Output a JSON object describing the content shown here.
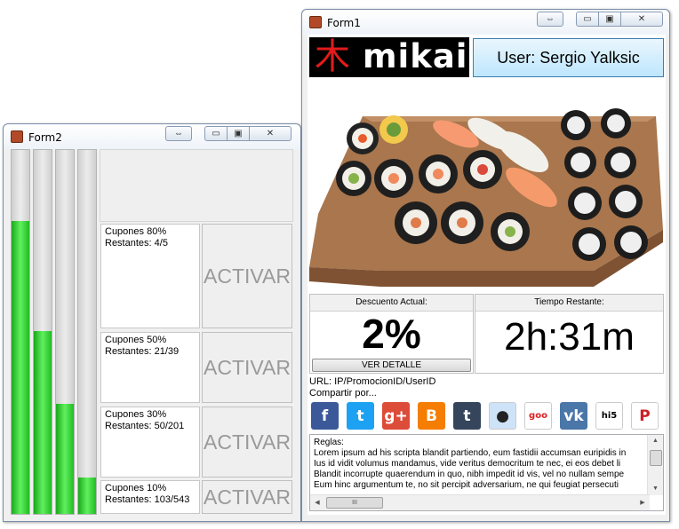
{
  "form2": {
    "title": "Form2",
    "title_buttons": {
      "resize_icon": "resize-arrows-icon",
      "minimize_icon": "minimize-icon",
      "restore_icon": "restore-icon",
      "close_icon": "close-icon",
      "resize_glyph": "⇔",
      "minimize_glyph": "▭",
      "restore_glyph": "▣",
      "close_glyph": "✕"
    },
    "bars": [
      {
        "name": "progress-bar-80",
        "fill_fraction": 0.8
      },
      {
        "name": "progress-bar-50",
        "fill_fraction": 0.5
      },
      {
        "name": "progress-bar-30",
        "fill_fraction": 0.3
      },
      {
        "name": "progress-bar-10",
        "fill_fraction": 0.1
      }
    ],
    "promos": [
      {
        "line1": "Cupones 80%",
        "line2": "Restantes: 4/5",
        "button": "ACTIVAR"
      },
      {
        "line1": "Cupones 50%",
        "line2": "Restantes: 21/39",
        "button": "ACTIVAR"
      },
      {
        "line1": "Cupones 30%",
        "line2": "Restantes: 50/201",
        "button": "ACTIVAR"
      },
      {
        "line1": "Cupones 10%",
        "line2": "Restantes: 103/543",
        "button": "ACTIVAR"
      }
    ],
    "colors": {
      "bar_fill": "#33cc33"
    }
  },
  "form1": {
    "title": "Form1",
    "logo": {
      "kanji": "木",
      "brand": "mikai"
    },
    "user_button": "User: Sergio Yalksic",
    "discount": {
      "label": "Descuento Actual:",
      "value": "2%",
      "detail_button": "VER DETALLE"
    },
    "time": {
      "label": "Tiempo Restante:",
      "value": "2h:31m"
    },
    "url_text": "URL: IP/PromocionID/UserID",
    "share_label": "Compartir por...",
    "share_icons": [
      {
        "name": "facebook-icon",
        "glyph": "f",
        "color": "#3b5998"
      },
      {
        "name": "twitter-icon",
        "glyph": "t",
        "color": "#1da1f2"
      },
      {
        "name": "google-plus-icon",
        "glyph": "g+",
        "color": "#dd4b39"
      },
      {
        "name": "blogger-icon",
        "glyph": "B",
        "color": "#f57d00"
      },
      {
        "name": "tumblr-icon",
        "glyph": "t",
        "color": "#35465c"
      },
      {
        "name": "reddit-icon",
        "glyph": "●",
        "color": "#cee3f8"
      },
      {
        "name": "goo-icon",
        "glyph": "goo",
        "color": "#ffffff"
      },
      {
        "name": "vk-icon",
        "glyph": "vk",
        "color": "#4a76a8"
      },
      {
        "name": "hi5-icon",
        "glyph": "hi5",
        "color": "#ffffff"
      },
      {
        "name": "pinterest-icon",
        "glyph": "P",
        "color": "#ffffff"
      }
    ],
    "rules": {
      "heading": "Reglas:",
      "lines": [
        "Lorem ipsum ad his scripta blandit partiendo, eum fastidii accumsan euripidis in",
        "Ius id vidit volumus mandamus, vide veritus democritum te nec, ei eos debet li",
        "Blandit incorrupte quaerendum in quo, nibh impedit id vis, vel no nullam sempe",
        "Eum hinc argumentum te, no sit percipit adversarium, ne qui feugiat persecuti"
      ]
    },
    "scroll": {
      "hscroll_glyph": "III",
      "up_glyph": "▲",
      "down_glyph": "▼",
      "left_glyph": "◀",
      "right_glyph": "▶"
    }
  }
}
